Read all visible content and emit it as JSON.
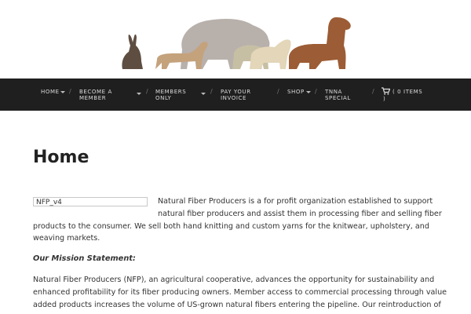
{
  "nav": {
    "items": [
      {
        "label_1": "HOME",
        "label_2": ""
      },
      {
        "label_1": "BECOME A",
        "label_2": "MEMBER"
      },
      {
        "label_1": "MEMBERS",
        "label_2": "ONLY"
      },
      {
        "label_1": "PAY YOUR",
        "label_2": "INVOICE"
      },
      {
        "label_1": "SHOP",
        "label_2": ""
      },
      {
        "label_1": "TNNA",
        "label_2": "SPECIAL"
      }
    ],
    "cart_line1": "( 0 ITEMS",
    "cart_line2": ")",
    "separator": "/"
  },
  "page": {
    "title": "Home",
    "image_alt": "NFP_v4",
    "intro_line1": "Natural Fiber Producers is a for profit organization established to support",
    "intro_line2": "natural fiber producers and assist them in processing fiber and selling fiber",
    "intro_line3": "products to the consumer.  We sell both hand knitting and custom yarns for the knitwear, upholstery, and",
    "intro_line4": "weaving markets.",
    "mission_heading": "Our Mission Statement:",
    "mission_line1": "Natural Fiber Producers (NFP), an agricultural cooperative, advances the opportunity for sustainability and",
    "mission_line2": "enhanced profitability for its fiber producing owners.  Member access to commercial processing through value",
    "mission_line3": "added products increases the volume of US-grown natural fibers entering the pipeline.  Our reintroduction of"
  },
  "colors": {
    "nav_bg": "#1f1f1f",
    "rabbit": "#5e4e42",
    "goat": "#c4a27c",
    "bison": "#b8b0ab",
    "sheep": "#e3d6b9",
    "sheep2": "#c7bfa4",
    "alpaca": "#9c5c35"
  }
}
